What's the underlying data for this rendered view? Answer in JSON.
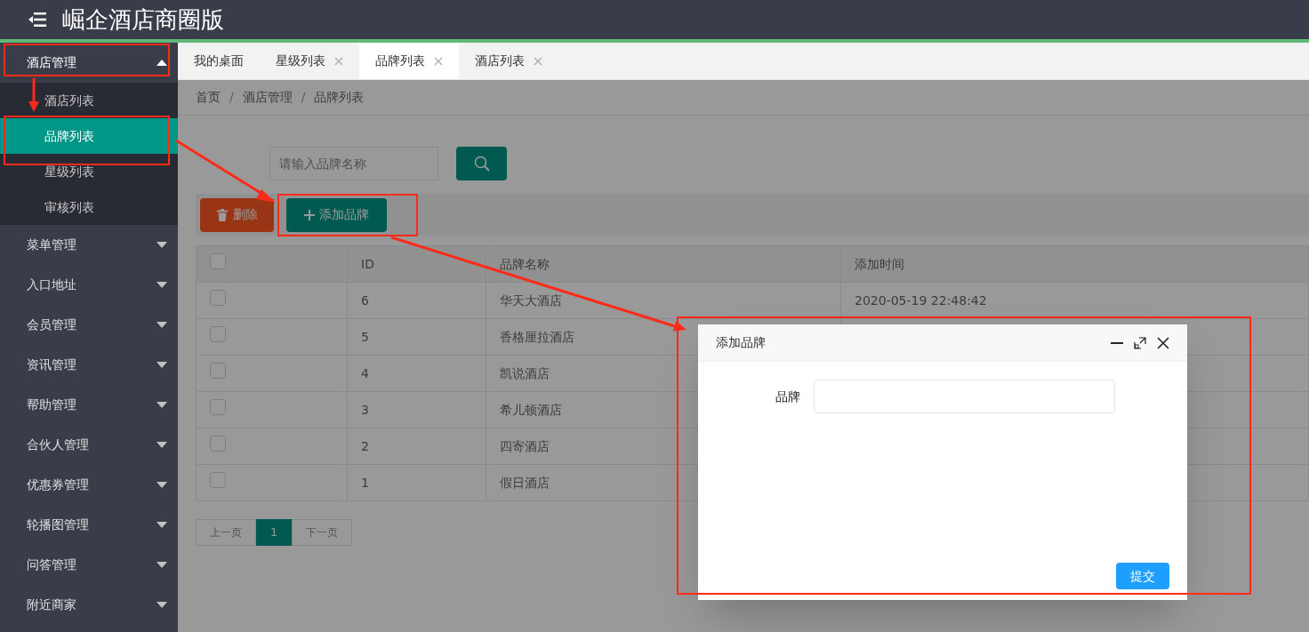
{
  "header": {
    "title": "崛企酒店商圈版"
  },
  "sidebar": {
    "items": [
      {
        "label": "酒店管理",
        "expanded": true,
        "children": [
          {
            "label": "酒店列表",
            "selected": false
          },
          {
            "label": "品牌列表",
            "selected": true
          },
          {
            "label": "星级列表",
            "selected": false
          },
          {
            "label": "审核列表",
            "selected": false
          }
        ]
      },
      {
        "label": "菜单管理",
        "expanded": false
      },
      {
        "label": "入口地址",
        "expanded": false
      },
      {
        "label": "会员管理",
        "expanded": false
      },
      {
        "label": "资讯管理",
        "expanded": false
      },
      {
        "label": "帮助管理",
        "expanded": false
      },
      {
        "label": "合伙人管理",
        "expanded": false
      },
      {
        "label": "优惠券管理",
        "expanded": false
      },
      {
        "label": "轮播图管理",
        "expanded": false
      },
      {
        "label": "问答管理",
        "expanded": false
      },
      {
        "label": "附近商家",
        "expanded": false
      }
    ]
  },
  "tabs": [
    {
      "label": "我的桌面",
      "closable": false,
      "selected": false
    },
    {
      "label": "星级列表",
      "closable": true,
      "selected": false
    },
    {
      "label": "品牌列表",
      "closable": true,
      "selected": true
    },
    {
      "label": "酒店列表",
      "closable": true,
      "selected": false
    }
  ],
  "breadcrumb": [
    "首页",
    "酒店管理",
    "品牌列表"
  ],
  "breadcrumb_separator": "/",
  "search": {
    "placeholder": "请输入品牌名称"
  },
  "toolbar": {
    "delete": "删除",
    "add": "添加品牌"
  },
  "table": {
    "header_checked": false,
    "columns": [
      "ID",
      "品牌名称",
      "添加时间"
    ],
    "rows": [
      {
        "checked": false,
        "id": "6",
        "name": "华天大酒店",
        "time": "2020-05-19 22:48:42"
      },
      {
        "checked": false,
        "id": "5",
        "name": "香格厘拉酒店"
      },
      {
        "checked": false,
        "id": "4",
        "name": "凯说酒店"
      },
      {
        "checked": false,
        "id": "3",
        "name": "希儿顿酒店"
      },
      {
        "checked": false,
        "id": "2",
        "name": "四寄酒店"
      },
      {
        "checked": false,
        "id": "1",
        "name": "假日酒店"
      }
    ]
  },
  "pagination": {
    "prev": "上一页",
    "pages": [
      {
        "label": "1",
        "selected": true
      }
    ],
    "next": "下一页"
  },
  "dialog": {
    "title": "添加品牌",
    "field_label": "品牌",
    "submit": "提交"
  }
}
